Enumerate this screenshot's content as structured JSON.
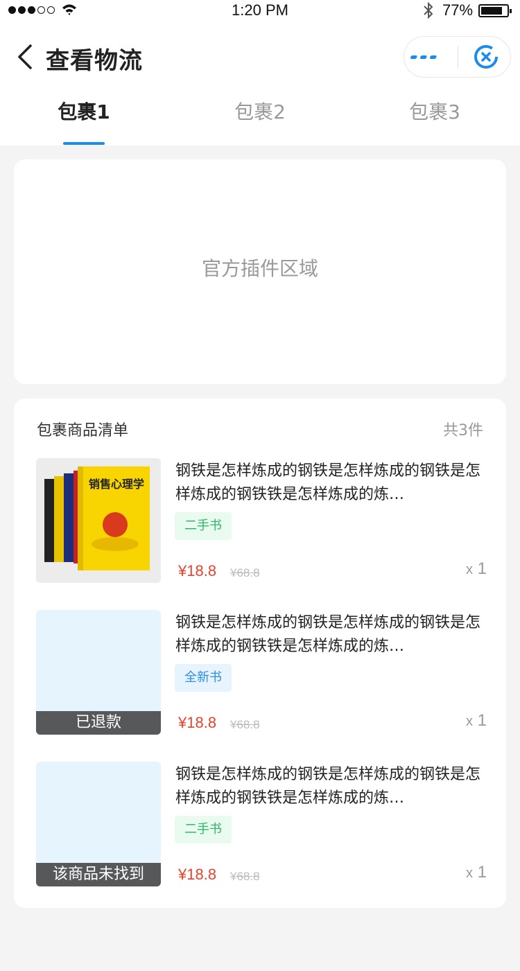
{
  "status_bar": {
    "time": "1:20 PM",
    "battery": "77%"
  },
  "nav": {
    "title": "查看物流"
  },
  "tabs": [
    {
      "label": "包裹1"
    },
    {
      "label": "包裹2"
    },
    {
      "label": "包裹3"
    }
  ],
  "plugin": {
    "placeholder": "官方插件区域"
  },
  "list": {
    "title": "包裹商品清单",
    "count": "共3件",
    "items": [
      {
        "title": "钢铁是怎样炼成的钢铁是怎样炼成的钢铁是怎样炼成的钢铁铁是怎样炼成的炼…",
        "tag": "二手书",
        "price": "¥18.8",
        "original_price": "¥68.8",
        "qty_prefix": "x",
        "qty": "1",
        "overlay": "",
        "cover_text": "销售心理学"
      },
      {
        "title": "钢铁是怎样炼成的钢铁是怎样炼成的钢铁是怎样炼成的钢铁铁是怎样炼成的炼…",
        "tag": "全新书",
        "price": "¥18.8",
        "original_price": "¥68.8",
        "qty_prefix": "x",
        "qty": "1",
        "overlay": "已退款"
      },
      {
        "title": "钢铁是怎样炼成的钢铁是怎样炼成的钢铁是怎样炼成的钢铁铁是怎样炼成的炼…",
        "tag": "二手书",
        "price": "¥18.8",
        "original_price": "¥68.8",
        "qty_prefix": "x",
        "qty": "1",
        "overlay": "该商品未找到"
      }
    ]
  },
  "colors": {
    "accent": "#1a8cf0",
    "price": "#e8422c",
    "used_tag": "#2fb86a",
    "new_tag": "#2b8ee6"
  }
}
